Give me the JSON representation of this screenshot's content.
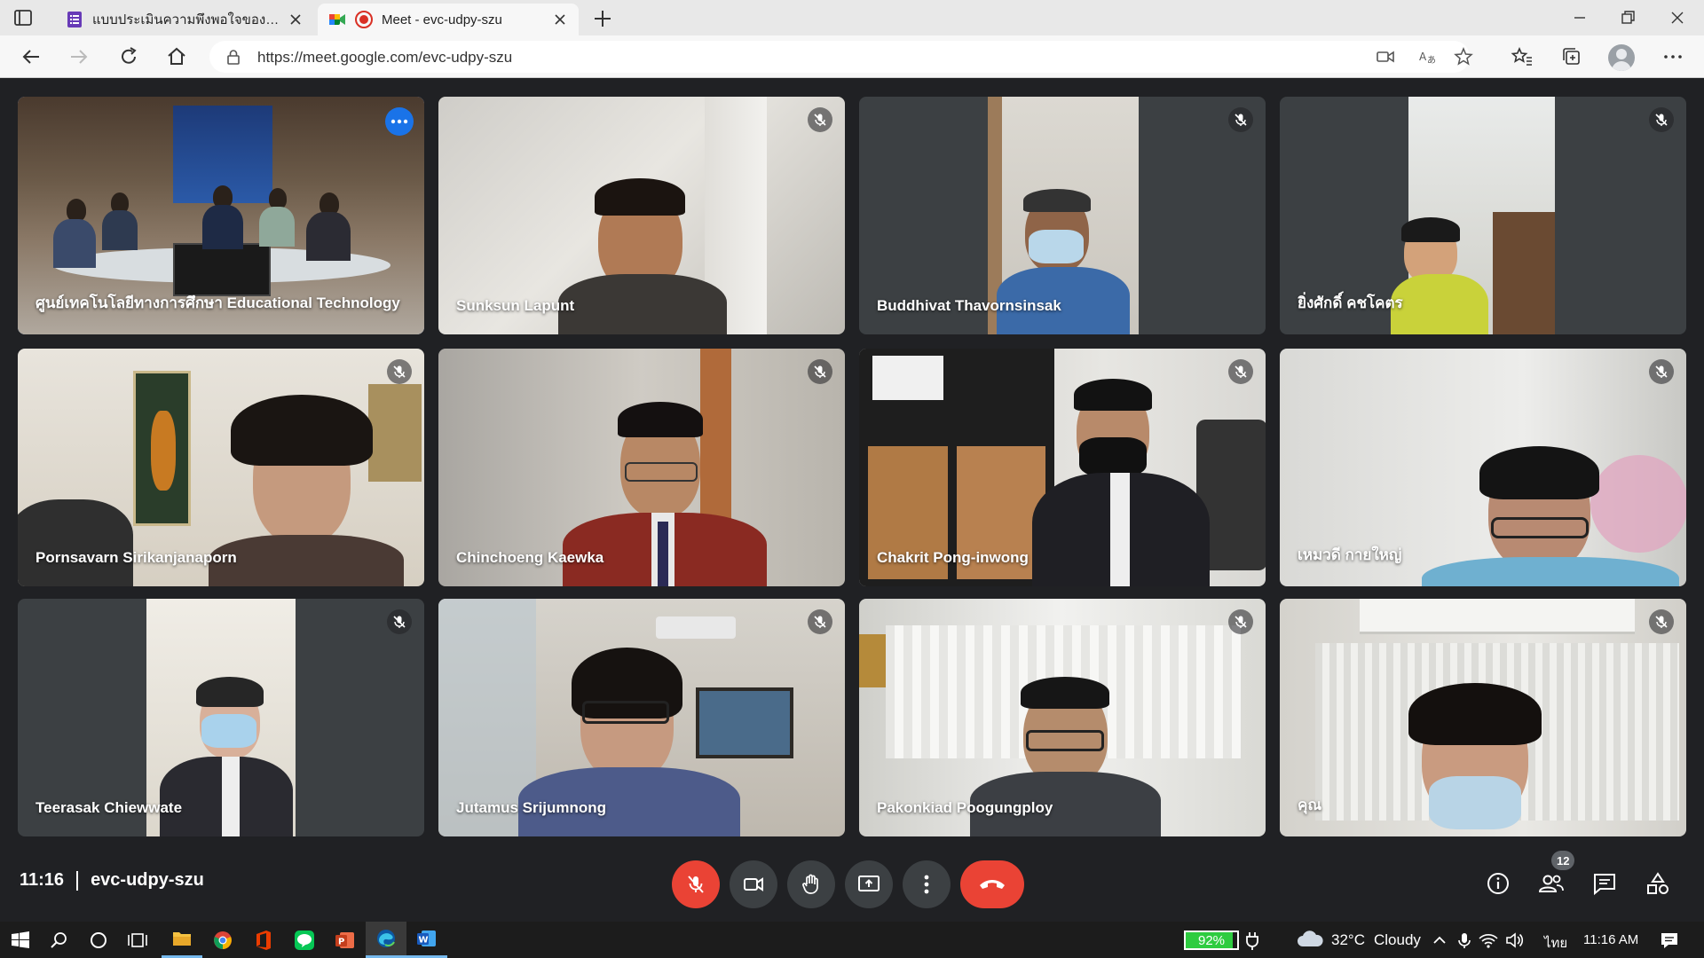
{
  "browser": {
    "tabs": [
      {
        "title": "แบบประเมินความพึงพอใจของผู้ใช้งานแ",
        "active": false,
        "favicon": "forms-icon"
      },
      {
        "title": "Meet - evc-udpy-szu",
        "active": true,
        "favicon": "meet-icon",
        "recording": true
      }
    ],
    "url": "https://meet.google.com/evc-udpy-szu"
  },
  "meet": {
    "participants": [
      {
        "name": "ศูนย์เทคโนโลยีทางการศึกษา Educational Technology",
        "muted": false,
        "pinned": true
      },
      {
        "name": "Sunksun Lapunt",
        "muted": true
      },
      {
        "name": "Buddhivat Thavornsinsak",
        "muted": true
      },
      {
        "name": "ยิ่งศักดิ์ คชโคตร",
        "muted": true
      },
      {
        "name": "Pornsavarn Sirikanjanaporn",
        "muted": true
      },
      {
        "name": "Chinchoeng Kaewka",
        "muted": true
      },
      {
        "name": "Chakrit Pong-inwong",
        "muted": true
      },
      {
        "name": "เหมวดี กายใหญ่",
        "muted": true
      },
      {
        "name": "Teerasak Chiewwate",
        "muted": true
      },
      {
        "name": "Jutamus Srijumnong",
        "muted": true
      },
      {
        "name": "Pakonkiad Poogungploy",
        "muted": true
      },
      {
        "name": "คุณ",
        "muted": true
      }
    ],
    "time": "11:16",
    "meeting_code": "evc-udpy-szu",
    "participant_count": "12"
  },
  "taskbar": {
    "battery": "92%",
    "battery_level": 0.92,
    "temperature": "32°C",
    "weather": "Cloudy",
    "language": "ไทย",
    "time": "11:16 AM"
  },
  "colors": {
    "meet_bg": "#202124",
    "accent": "#8ab4f8",
    "danger": "#ea4335",
    "control_bg": "#3c4043"
  }
}
